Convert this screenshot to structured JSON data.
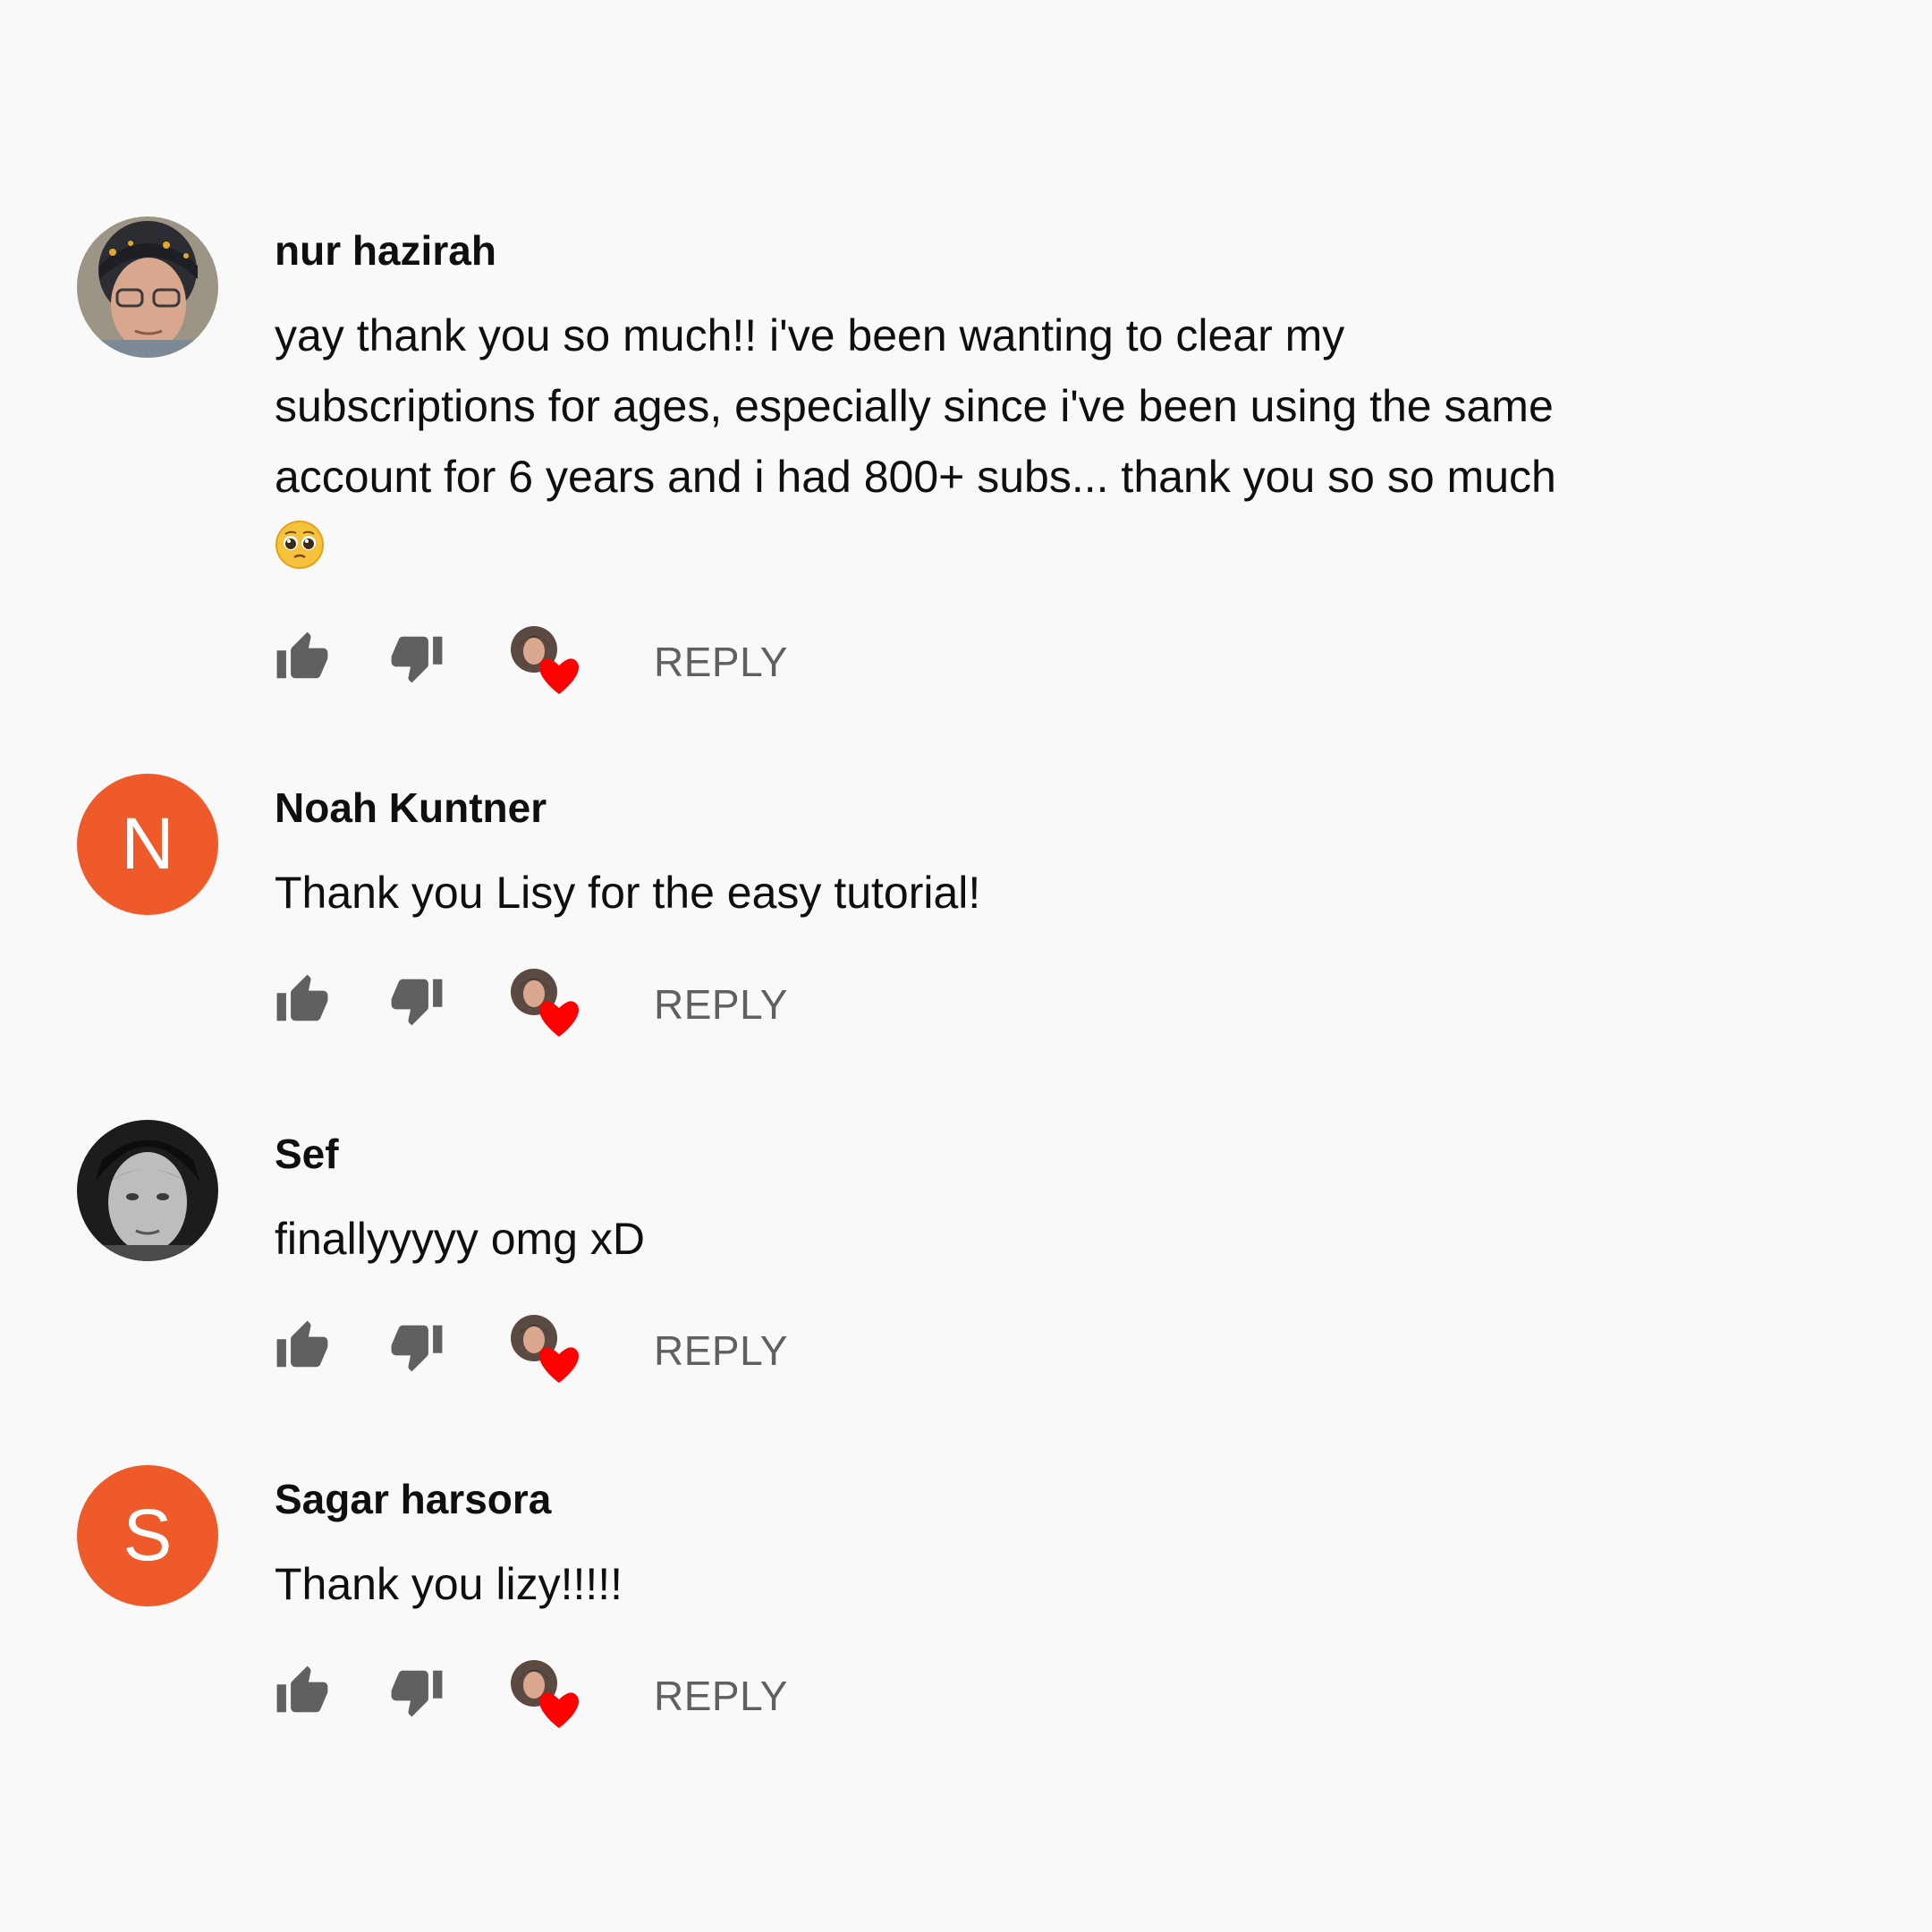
{
  "comments": [
    {
      "author": "nur hazirah",
      "text": "yay thank you so much!! i've been wanting to clear my\nsubscriptions for ages, especially since i've been using the same\naccount for 6 years and i had 800+ subs... thank you so so much",
      "has_emoji": true,
      "emoji_icon": "pleading-face-emoji",
      "avatar_type": "photo",
      "reply_label": "REPLY"
    },
    {
      "author": "Noah Kuntner",
      "text": "Thank you Lisy for the easy tutorial!",
      "avatar_type": "letter",
      "avatar_letter": "N",
      "reply_label": "REPLY"
    },
    {
      "author": "Sef",
      "text": "finallyyyyy omg xD",
      "avatar_type": "photo",
      "reply_label": "REPLY"
    },
    {
      "author": "Sagar harsora",
      "text": "Thank you lizy!!!!!",
      "avatar_type": "letter",
      "avatar_letter": "S",
      "reply_label": "REPLY"
    }
  ],
  "icons": {
    "like": "thumbs-up-icon",
    "dislike": "thumbs-down-icon",
    "creator_heart": "creator-heart-icon"
  },
  "colors": {
    "background": "#f9f9f9",
    "letter_avatar": "#ef5a2a",
    "heart": "#ff0000",
    "secondary_text": "#606060",
    "icon": "#606060"
  }
}
